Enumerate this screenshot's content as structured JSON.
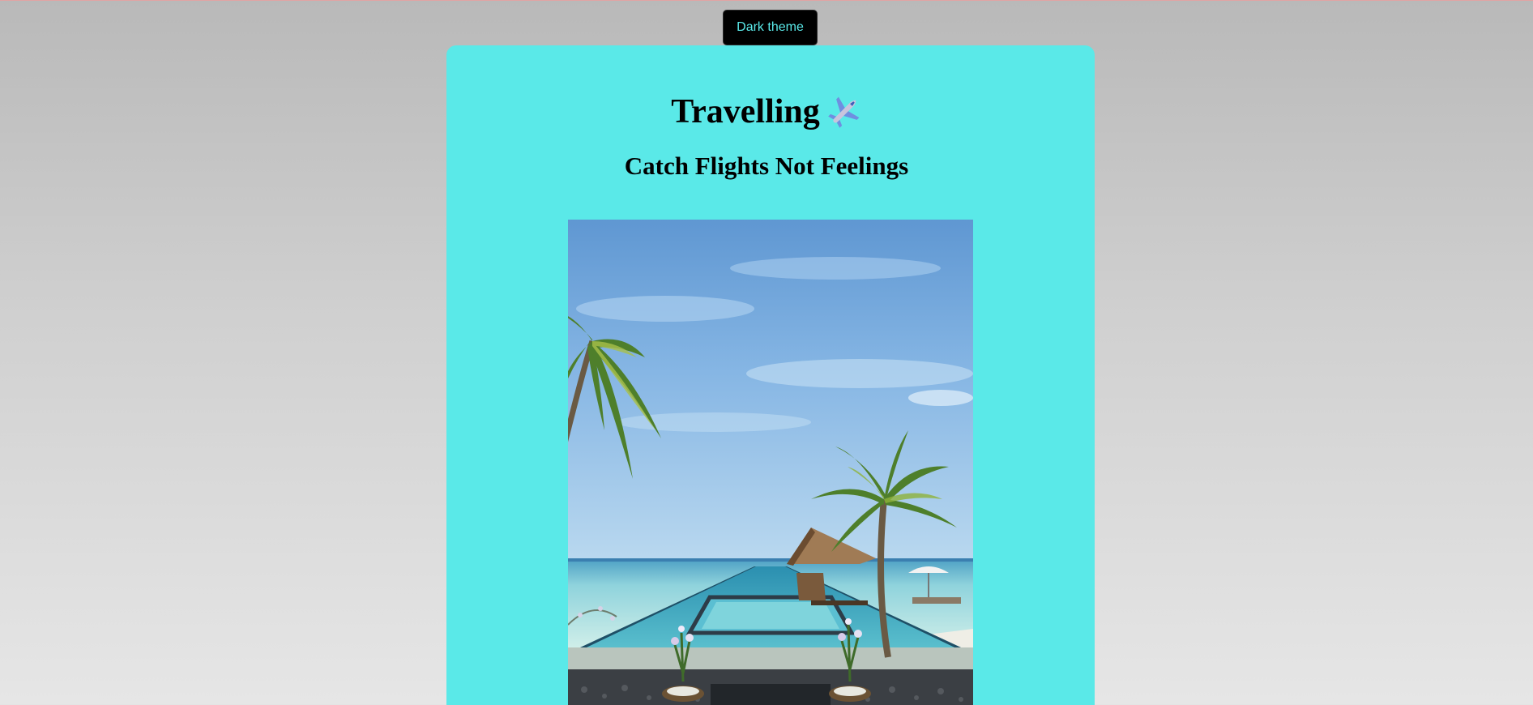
{
  "theme_toggle": {
    "label": "Dark theme"
  },
  "header": {
    "title": "Travelling",
    "subtitle": "Catch Flights Not Feelings"
  },
  "icons": {
    "title_icon": "airplane-icon"
  },
  "colors": {
    "card_background": "#5ae9e8",
    "button_background": "#000000",
    "button_text": "#5ae9e9",
    "page_gradient_top": "#b9b9b9",
    "page_gradient_bottom": "#e6e6e6"
  }
}
